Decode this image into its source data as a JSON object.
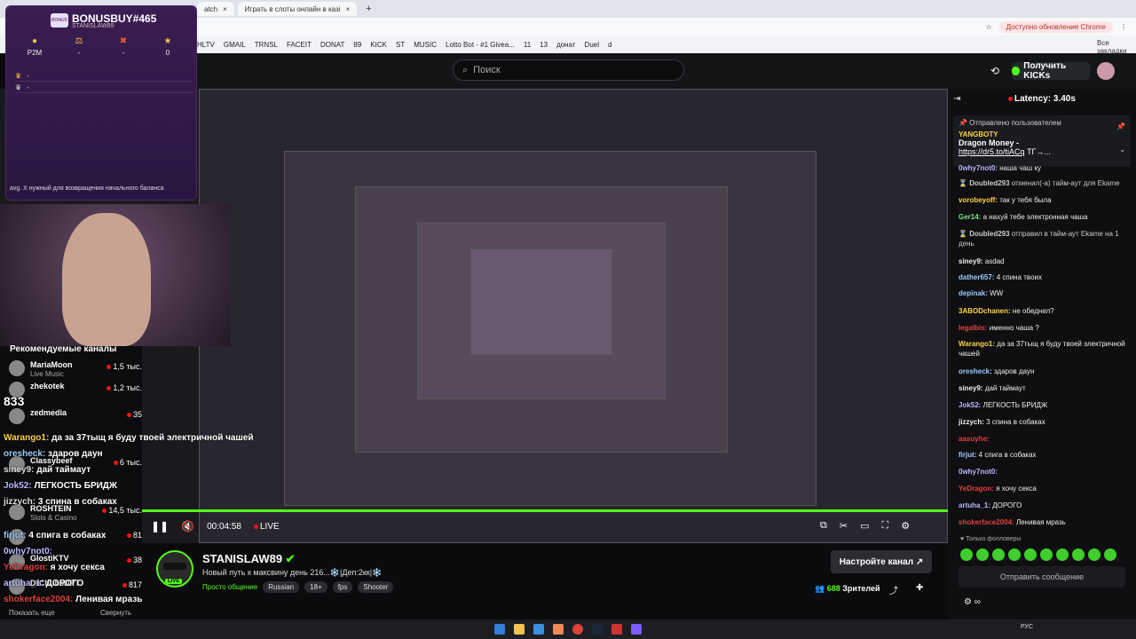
{
  "browser": {
    "tabs": [
      "atch",
      "Играть в слоты онлайн в казі"
    ],
    "bookmarks": [
      "HLTV",
      "GMAIL",
      "TRNSL",
      "FACEIT",
      "DONAT",
      "89",
      "KICK",
      "ST",
      "MUSIC",
      "Lotto Bot - #1 Givea...",
      "11",
      "13",
      "донат",
      "Duel",
      "d"
    ],
    "update_button": "Доступно обновление Chrome",
    "all_bookmarks": "Все закладки"
  },
  "kick": {
    "search_placeholder": "Поиск",
    "get_kicks": "Получить KICKs"
  },
  "overlay": {
    "title": "BONUSBUY#465",
    "subtitle": "STANISLAW89",
    "logo": "BONUS",
    "stats": [
      {
        "icon": "coin",
        "value": "P2M"
      },
      {
        "icon": "balance",
        "value": "-"
      },
      {
        "icon": "x",
        "value": "-"
      },
      {
        "icon": "star",
        "value": "0"
      }
    ],
    "rows": [
      "-",
      "-"
    ],
    "chat_line": "avg. X нужный для возвращения начального баланса"
  },
  "recommended": {
    "title": "Рекомендуемые каналы",
    "channels": [
      {
        "name": "MariaMoon",
        "game": "Live Music",
        "viewers": "1,5 тыс."
      },
      {
        "name": "zhekotek",
        "game": "",
        "viewers": "1,2 тыс."
      },
      {
        "name": "zedmedia",
        "game": "",
        "viewers": "35"
      },
      {
        "name": "Classybeef",
        "game": "",
        "viewers": "6 тыс."
      },
      {
        "name": "ROSHTEIN",
        "game": "Slots & Casino",
        "viewers": "14,5 тыс."
      },
      {
        "name": "",
        "game": "",
        "viewers": "81"
      },
      {
        "name": "GlostiKTV",
        "game": "",
        "viewers": "38"
      },
      {
        "name": "DrChubsDPT",
        "game": "",
        "viewers": "817"
      }
    ],
    "show_more": "Показать еще",
    "collapse": "Свернуть"
  },
  "overlay_chat": [
    {
      "user": "833",
      "text": ""
    },
    {
      "user": "Warango1:",
      "text": "да за 37тыщ я буду твоей электричной чашей"
    },
    {
      "user": "oresheck:",
      "text": "здаров даун"
    },
    {
      "user": "siney9:",
      "text": "дай таймаут"
    },
    {
      "user": "Jok52:",
      "text": "ЛЕГКОСТЬ БРИДЖ"
    },
    {
      "user": "jizzych:",
      "text": "3 спина в собаках"
    },
    {
      "user": "firjut:",
      "text": "4 спига в собаках"
    },
    {
      "user": "0why7not0:",
      "text": ""
    },
    {
      "user": "YeDragon:",
      "text": "я хочу секса"
    },
    {
      "user": "artuha_1:",
      "text": "ДОРОГО"
    },
    {
      "user": "shokerface2004:",
      "text": "Ленивая мразь"
    }
  ],
  "player": {
    "time": "00:04:58",
    "live": "LIVE"
  },
  "channel": {
    "name": "STANISLAW89",
    "title": "Новый путь к максвину день 216...❄️|Деп:2кк|❄️",
    "category": "Просто общение",
    "tags": [
      "Russian",
      "18+",
      "fps",
      "Shooter"
    ],
    "customize": "Настройте канал",
    "viewers": "688",
    "viewers_label": "Зрителей",
    "live_badge": "LIVE"
  },
  "chat": {
    "latency": "Latency: 3.40s",
    "pinned_label": "Отправлено пользователем",
    "pinned_user": "YANGBOTY",
    "pinned_text": "Dragon Money -",
    "pinned_link": "https://dr5.to/tiACq",
    "pinned_tail": "ТГ→...",
    "messages": [
      {
        "user": "0why7not0:",
        "text": "наша чаш ку",
        "color": "#b9b9ff"
      },
      {
        "user": "Doubled293",
        "text": "отменил(-а) тайм-аут для Ekame",
        "color": "#ccc",
        "sys": true
      },
      {
        "user": "vorobeyoff:",
        "text": "так у тебя была",
        "color": "#ffd24a"
      },
      {
        "user": "Ger14:",
        "text": "а нахуй тебе электронная чаша",
        "color": "#7fe07f"
      },
      {
        "user": "Doubled293",
        "text": "отправил в тайм-аут Ekame на 1 день",
        "color": "#ccc",
        "sys": true
      },
      {
        "user": "siney9:",
        "text": "asdad",
        "color": "#eee"
      },
      {
        "user": "dather657:",
        "text": "4 спина твоих",
        "color": "#9cf"
      },
      {
        "user": "depinak:",
        "text": "WW",
        "color": "#9cf"
      },
      {
        "user": "3ABODchanen:",
        "text": "не обеднел?",
        "color": "#ffd24a"
      },
      {
        "user": "legalbis:",
        "text": "именно чаша ?",
        "color": "#e04040"
      },
      {
        "user": "Warango1:",
        "text": "да за 37тыщ я буду твоей электричной чашей",
        "color": "#ffd24a"
      },
      {
        "user": "oresheck:",
        "text": "здаров даун",
        "color": "#9cf"
      },
      {
        "user": "siney9:",
        "text": "дай таймаут",
        "color": "#eee"
      },
      {
        "user": "Jok52:",
        "text": "ЛЕГКОСТЬ БРИДЖ",
        "color": "#b9b9ff"
      },
      {
        "user": "jizzych:",
        "text": "3 спина в собаках",
        "color": "#eee"
      },
      {
        "user": "aasuyhe:",
        "text": "",
        "color": "#e04040"
      },
      {
        "user": "firjut:",
        "text": "4 спига в собаках",
        "color": "#9cf"
      },
      {
        "user": "0why7not0:",
        "text": "",
        "color": "#b9b9ff"
      },
      {
        "user": "YeDragon:",
        "text": "я хочу секса",
        "color": "#e04040"
      },
      {
        "user": "artuha_1:",
        "text": "ДОРОГО",
        "color": "#b9b9ff"
      },
      {
        "user": "shokerface2004:",
        "text": "Ленивая мразь",
        "color": "#e04040"
      }
    ],
    "followers_only": "Только фолловеры",
    "send_placeholder": "Отправить сообщение"
  },
  "taskbar": {
    "lang": "РУС"
  },
  "colors": {
    "accent": "#53fc18",
    "bg": "#0b0b0d"
  }
}
